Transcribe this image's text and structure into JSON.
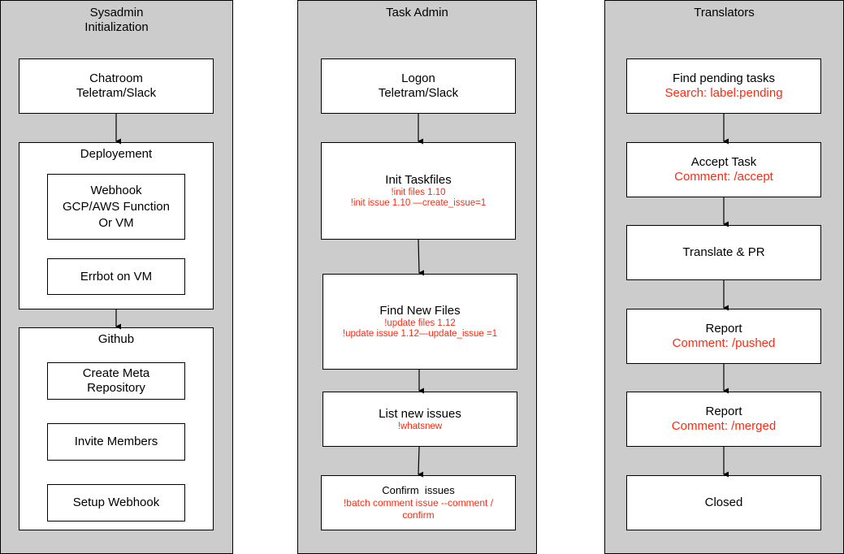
{
  "lanes": [
    {
      "title": "Sysadmin\nInitialization",
      "chatroom": {
        "title": "Chatroom\nTeletram/Slack"
      },
      "deployment": {
        "title": "Deployement",
        "items": [
          {
            "title": "Webhook\nGCP/AWS Function\nOr VM"
          },
          {
            "title": "Errbot on VM"
          }
        ]
      },
      "github": {
        "title": "Github",
        "items": [
          {
            "title": "Create Meta\nRepository"
          },
          {
            "title": "Invite Members"
          },
          {
            "title": "Setup Webhook"
          }
        ]
      }
    },
    {
      "title": "Task Admin",
      "steps": [
        {
          "title": "Logon\nTeletram/Slack",
          "command": ""
        },
        {
          "title": "Init Taskfiles",
          "command": "!init files 1.10\n!init issue 1.10 —create_issue=1"
        },
        {
          "title": "Find New Files",
          "command": "!update files 1.12\n!update issue 1.12—update_issue =1"
        },
        {
          "title": "List new issues",
          "command": "!whatsnew"
        },
        {
          "title": "Confirm  issues",
          "command": "!batch comment issue --comment /\nconfirm"
        }
      ]
    },
    {
      "title": "Translators",
      "steps": [
        {
          "title": "Find pending tasks",
          "command": "Search: label:pending"
        },
        {
          "title": "Accept Task",
          "command": "Comment: /accept"
        },
        {
          "title": "Translate & PR",
          "command": ""
        },
        {
          "title": "Report",
          "command": "Comment: /pushed"
        },
        {
          "title": "Report",
          "command": "Comment: /merged"
        },
        {
          "title": "Closed",
          "command": ""
        }
      ]
    }
  ],
  "colors": {
    "lane_bg": "#cccccc",
    "box_bg": "#ffffff",
    "command_text": "#ff2a12",
    "stroke": "#000000"
  }
}
